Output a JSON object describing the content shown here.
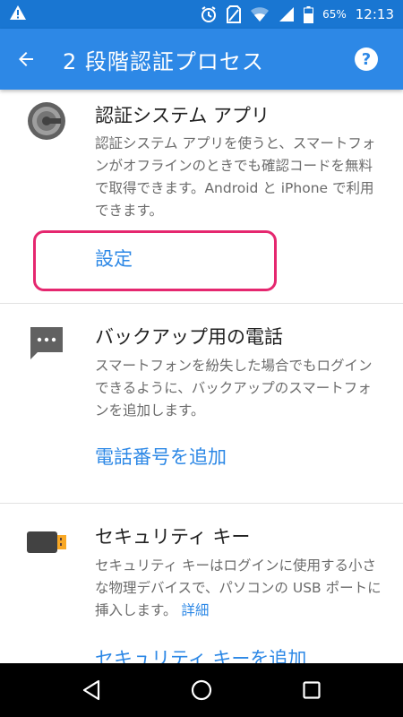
{
  "status_bar": {
    "battery": "65%",
    "time": "12:13",
    "icons": [
      "warning-icon",
      "alarm-icon",
      "no-sim-icon",
      "wifi-icon",
      "signal-icon",
      "battery-icon"
    ]
  },
  "app_bar": {
    "title": "2 段階認証プロセス",
    "back_icon": "arrow-back-icon",
    "help_icon": "help-icon"
  },
  "sections": [
    {
      "icon": "authenticator-icon",
      "title": "認証システム アプリ",
      "desc": "認証システム アプリを使うと、スマートフォンがオフラインのときでも確認コードを無料で取得できます。Android と iPhone で利用できます。",
      "link": "設定"
    },
    {
      "icon": "message-icon",
      "title": "バックアップ用の電話",
      "desc": "スマートフォンを紛失した場合でもログインできるように、バックアップのスマートフォンを追加します。",
      "link": "電話番号を追加"
    },
    {
      "icon": "security-key-icon",
      "title": "セキュリティ キー",
      "desc": "セキュリティ キーはログインに使用する小さな物理デバイスで、パソコンの USB ポートに挿入します。",
      "desc_link": "詳細",
      "link": "セキュリティ キーを追加"
    }
  ],
  "nav_bar": {
    "icons": [
      "back-triangle-icon",
      "home-circle-icon",
      "recents-square-icon"
    ]
  },
  "colors": {
    "status_bar": "#1976d2",
    "app_bar": "#2d88e6",
    "link": "#2d88e6",
    "highlight": "#e5276f"
  }
}
